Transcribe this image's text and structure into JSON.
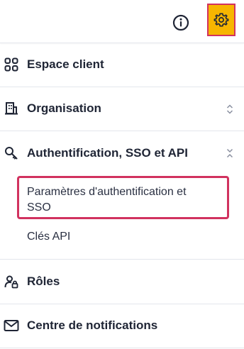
{
  "header": {
    "info_icon": "info-circle-icon",
    "settings_icon": "gear-icon",
    "settings_highlight_color": "#f7b500",
    "focus_border_color": "#d1325f"
  },
  "menu": {
    "items": [
      {
        "label": "Espace client",
        "icon": "grid-icon"
      },
      {
        "label": "Organisation",
        "icon": "building-icon",
        "chevron": "expand"
      },
      {
        "label": "Authentification, SSO et API",
        "icon": "key-icon",
        "chevron": "collapse",
        "children": [
          {
            "label": "Paramètres d'authentification et SSO",
            "line1": "Paramètres d'authentification et",
            "line2": "SSO",
            "selected": true
          },
          {
            "label": "Clés API"
          }
        ]
      },
      {
        "label": "Rôles",
        "icon": "user-lock-icon"
      },
      {
        "label": "Centre de notifications",
        "icon": "envelope-icon"
      }
    ]
  }
}
